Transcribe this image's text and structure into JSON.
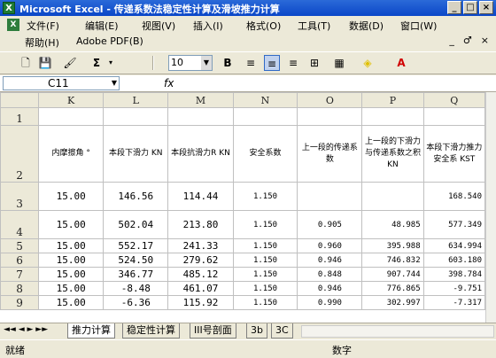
{
  "window": {
    "app_icon": "X",
    "title": "Microsoft Excel - 传递系数法稳定性计算及滑坡推力计算"
  },
  "menu": {
    "icon": "X",
    "items": [
      "文件(F)",
      "编辑(E)",
      "视图(V)",
      "插入(I)",
      "格式(O)",
      "工具(T)",
      "数据(D)",
      "窗口(W)",
      "帮助(H)",
      "Adobe PDF(B)"
    ],
    "right_controls": [
      "_",
      "♂",
      "×"
    ]
  },
  "toolbar": {
    "font_size": "10",
    "bold": "B"
  },
  "formula": {
    "cell_ref": "C11",
    "fx": "fx",
    "content": ""
  },
  "columns": [
    "K",
    "L",
    "M",
    "N",
    "O",
    "P",
    "Q"
  ],
  "header_row": {
    "K": "内摩擦角 °",
    "L": "本段下滑力 KN",
    "M": "本段抗滑力R KN",
    "N": "安全系数",
    "O": "上一段的传递系数",
    "P": "上一段的下滑力与传递系数之积 KN",
    "Q": "本段下滑力推力安全系 KST"
  },
  "rows": [
    {
      "num": "1",
      "K": "",
      "L": "",
      "M": "",
      "N": "",
      "O": "",
      "P": "",
      "Q": ""
    },
    {
      "num": "2",
      "header": true
    },
    {
      "num": "3",
      "K": "15.00",
      "L": "146.56",
      "M": "114.44",
      "N": "1.150",
      "O": "",
      "P": "",
      "Q": "168.540"
    },
    {
      "num": "4",
      "K": "15.00",
      "L": "502.04",
      "M": "213.80",
      "N": "1.150",
      "O": "0.905",
      "P": "48.985",
      "Q": "577.349"
    },
    {
      "num": "5",
      "K": "15.00",
      "L": "552.17",
      "M": "241.33",
      "N": "1.150",
      "O": "0.960",
      "P": "395.988",
      "Q": "634.994"
    },
    {
      "num": "6",
      "K": "15.00",
      "L": "524.50",
      "M": "279.62",
      "N": "1.150",
      "O": "0.946",
      "P": "746.832",
      "Q": "603.180"
    },
    {
      "num": "7",
      "K": "15.00",
      "L": "346.77",
      "M": "485.12",
      "N": "1.150",
      "O": "0.848",
      "P": "907.744",
      "Q": "398.784"
    },
    {
      "num": "8",
      "K": "15.00",
      "L": "-8.48",
      "M": "461.07",
      "N": "1.150",
      "O": "0.946",
      "P": "776.865",
      "Q": "-9.751"
    },
    {
      "num": "9",
      "K": "15.00",
      "L": "-6.36",
      "M": "115.92",
      "N": "1.150",
      "O": "0.990",
      "P": "302.997",
      "Q": "-7.317"
    }
  ],
  "tabs": {
    "nav": "◄◄ ◄ ► ►►",
    "sheets": [
      "推力计算",
      "稳定性计算",
      "III号剖面",
      "3b",
      "3C"
    ]
  },
  "status": {
    "left": "就绪",
    "mode": "数字"
  }
}
